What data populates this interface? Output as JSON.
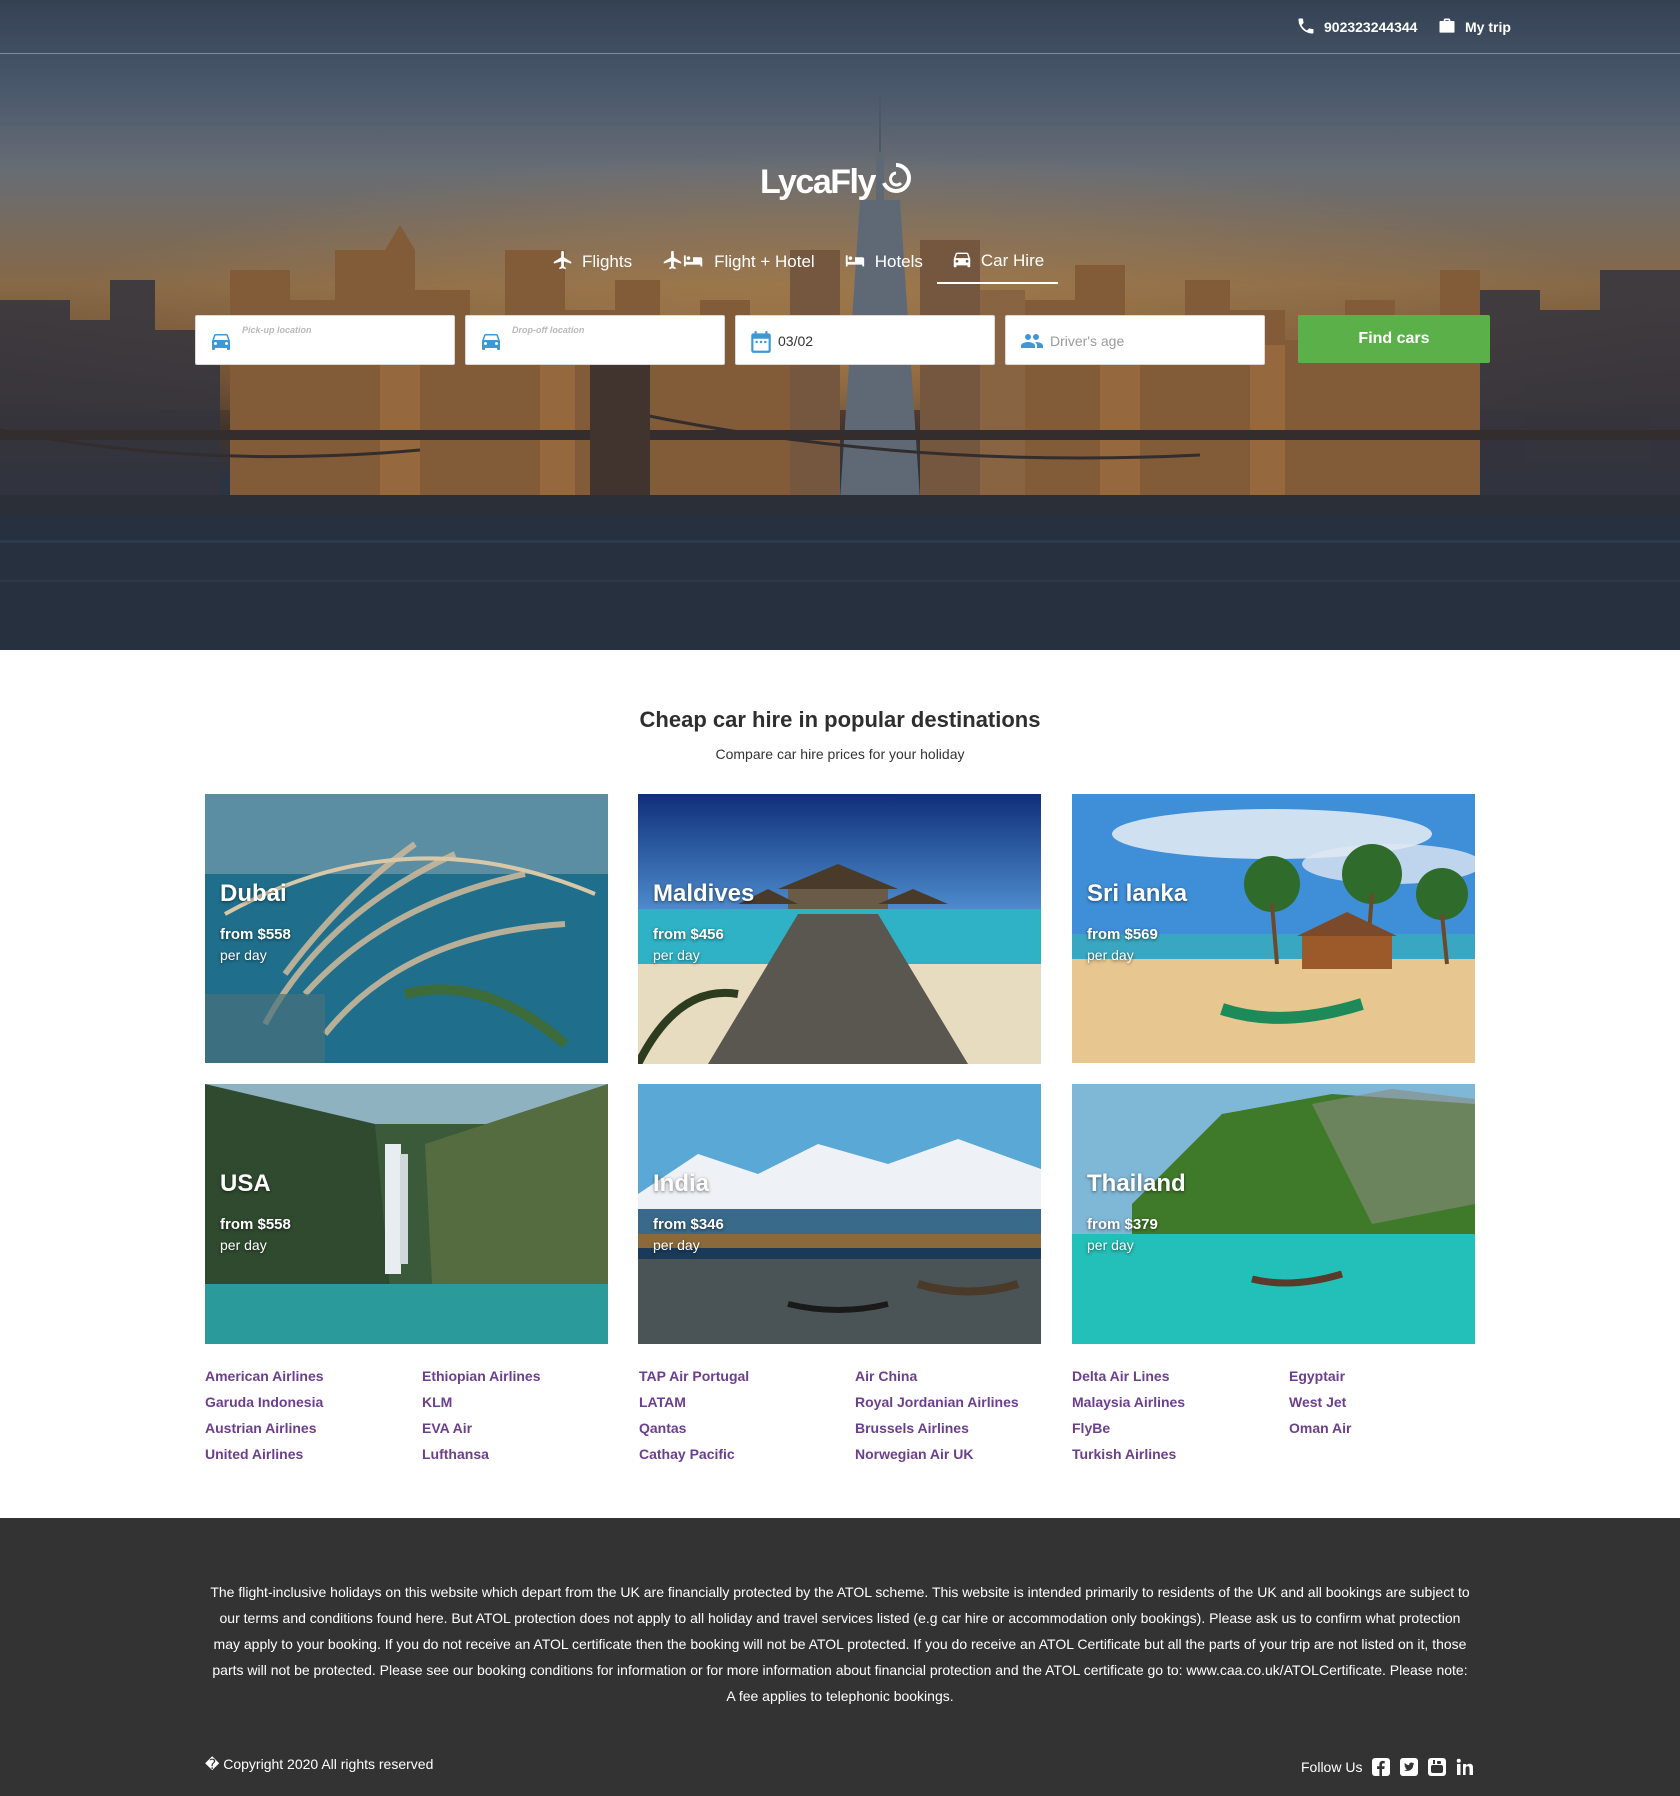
{
  "header": {
    "phone": "902323244344",
    "my_trip": "My trip"
  },
  "brand": {
    "name": "LycaFly"
  },
  "tabs": [
    {
      "label": "Flights",
      "icon": "plane-icon"
    },
    {
      "label": "Flight + Hotel",
      "icon": "plane-bed-icon"
    },
    {
      "label": "Hotels",
      "icon": "bed-icon"
    },
    {
      "label": "Car Hire",
      "icon": "car-icon",
      "active": true
    }
  ],
  "search": {
    "pickup_label": "Pick-up location",
    "dropoff_label": "Drop-off location",
    "date_value": "03/02",
    "age_placeholder": "Driver's age",
    "button": "Find cars",
    "button_color": "#5bb04a"
  },
  "destinations": {
    "title": "Cheap car hire in popular destinations",
    "subtitle": "Compare car hire prices for your holiday",
    "cards": [
      {
        "name": "Dubai",
        "price": "from $558",
        "unit": "per day"
      },
      {
        "name": "Maldives",
        "price": "from $456",
        "unit": "per day"
      },
      {
        "name": "Sri lanka",
        "price": "from $569",
        "unit": "per day"
      },
      {
        "name": "USA",
        "price": "from $558",
        "unit": "per day"
      },
      {
        "name": "India",
        "price": "from $346",
        "unit": "per day"
      },
      {
        "name": "Thailand",
        "price": "from $379",
        "unit": "per day"
      }
    ]
  },
  "airlines": {
    "link_color": "#6b3f8e",
    "columns": [
      [
        "American Airlines",
        "Garuda Indonesia",
        "Austrian Airlines",
        "United Airlines"
      ],
      [
        "Ethiopian Airlines",
        "KLM",
        "EVA Air",
        "Lufthansa"
      ],
      [
        "TAP Air Portugal",
        "LATAM",
        "Qantas",
        "Cathay Pacific"
      ],
      [
        "Air China",
        "Royal Jordanian Airlines",
        "Brussels Airlines",
        "Norwegian Air UK"
      ],
      [
        "Delta Air Lines",
        "Malaysia Airlines",
        "FlyBe",
        "Turkish Airlines"
      ],
      [
        "Egyptair",
        "West Jet",
        "Oman Air"
      ]
    ]
  },
  "footer": {
    "atol_text": "The flight-inclusive holidays on this website which depart from the UK are financially protected by the ATOL scheme. This website is intended primarily to residents of the UK and all bookings are subject to our terms and conditions found here. But ATOL protection does not apply to all holiday and travel services listed (e.g car hire or accommodation only bookings). Please ask us to confirm what protection may apply to your booking. If you do not receive an ATOL certificate then the booking will not be ATOL protected. If you do receive an ATOL Certificate but all the parts of your trip are not listed on it, those parts will not be protected. Please see our booking conditions for information or for more information about financial protection and the ATOL certificate go to: www.caa.co.uk/ATOLCertificate. Please note: A fee applies to telephonic bookings.",
    "copyright": "� Copyright 2020 All rights reserved",
    "follow_us": "Follow Us",
    "social": [
      "facebook-icon",
      "twitter-icon",
      "youtube-icon",
      "linkedin-icon"
    ]
  }
}
